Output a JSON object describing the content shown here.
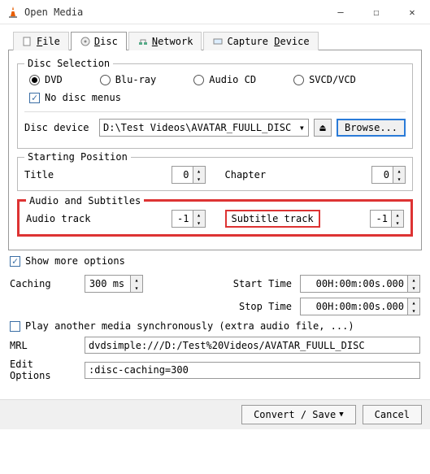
{
  "window": {
    "title": "Open Media"
  },
  "tabs": {
    "file": "File",
    "disc": "Disc",
    "network": "Network",
    "capture": "Capture Device"
  },
  "disc_selection": {
    "legend": "Disc Selection",
    "dvd": "DVD",
    "bluray": "Blu-ray",
    "audiocd": "Audio CD",
    "svcd": "SVCD/VCD",
    "no_menus": "No disc menus",
    "device_label": "Disc device",
    "device_value": "D:\\Test Videos\\AVATAR_FUULL_DISC",
    "browse": "Browse..."
  },
  "starting_position": {
    "legend": "Starting Position",
    "title_label": "Title",
    "title_value": "0",
    "chapter_label": "Chapter",
    "chapter_value": "0"
  },
  "audio_subs": {
    "legend": "Audio and Subtitles",
    "audio_label": "Audio track",
    "audio_value": "-1",
    "subtitle_label": "Subtitle track",
    "subtitle_value": "-1"
  },
  "show_more": "Show more options",
  "options": {
    "caching_label": "Caching",
    "caching_value": "300 ms",
    "start_label": "Start Time",
    "start_value": "00H:00m:00s.000",
    "stop_label": "Stop Time",
    "stop_value": "00H:00m:00s.000",
    "sync_label": "Play another media synchronously (extra audio file, ...)",
    "mrl_label": "MRL",
    "mrl_value": "dvdsimple:///D:/Test%20Videos/AVATAR_FUULL_DISC",
    "edit_label": "Edit Options",
    "edit_value": ":disc-caching=300"
  },
  "buttons": {
    "convert": "Convert / Save",
    "cancel": "Cancel"
  },
  "glyphs": {
    "dash": "—",
    "square": "☐",
    "close": "✕",
    "check": "✓",
    "down": "▾",
    "up": "▴",
    "eject": "⏏",
    "dropdown": "▼"
  }
}
